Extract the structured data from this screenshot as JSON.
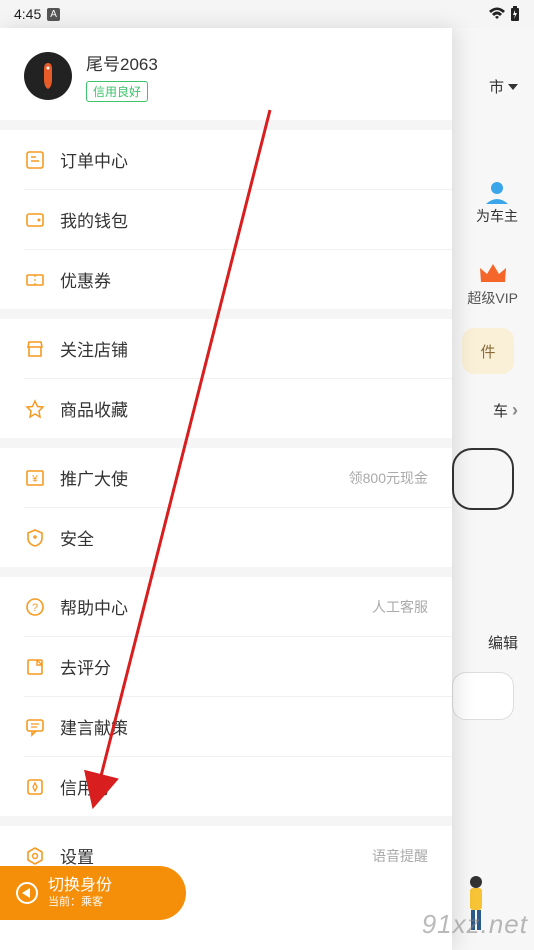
{
  "status": {
    "time": "4:45",
    "badge": "A"
  },
  "profile": {
    "nickname": "尾号2063",
    "credit": "信用良好"
  },
  "menu": {
    "orders": "订单中心",
    "wallet": "我的钱包",
    "coupons": "优惠券",
    "shops": "关注店铺",
    "favorites": "商品收藏",
    "promoter": "推广大使",
    "promoter_hint": "领800元现金",
    "safety": "安全",
    "help": "帮助中心",
    "help_hint": "人工客服",
    "rate": "去评分",
    "feedback": "建言献策",
    "credit_score": "信用分",
    "settings": "设置",
    "settings_hint": "语音提醒"
  },
  "switch": {
    "title": "切换身份",
    "sub_prefix": "当前：",
    "sub_role": "乘客"
  },
  "backdrop": {
    "city_suffix": "市",
    "owner": "为车主",
    "vip": "超级VIP",
    "card": "件",
    "car": "车",
    "edit": "编辑"
  },
  "watermark": "91xz.net"
}
